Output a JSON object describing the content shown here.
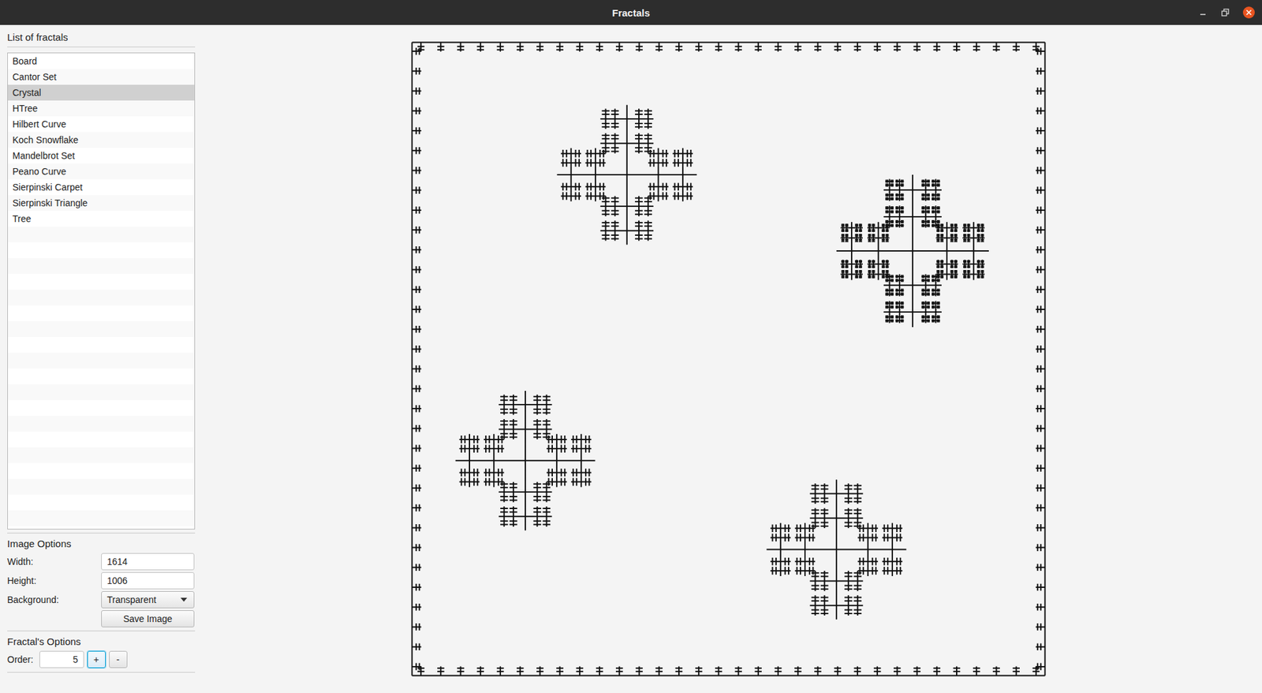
{
  "window": {
    "title": "Fractals"
  },
  "fractal_list": {
    "title": "List of fractals",
    "items": [
      {
        "label": "Board",
        "selected": false
      },
      {
        "label": "Cantor Set",
        "selected": false
      },
      {
        "label": "Crystal",
        "selected": true
      },
      {
        "label": "HTree",
        "selected": false
      },
      {
        "label": "Hilbert Curve",
        "selected": false
      },
      {
        "label": "Koch Snowflake",
        "selected": false
      },
      {
        "label": "Mandelbrot Set",
        "selected": false
      },
      {
        "label": "Peano Curve",
        "selected": false
      },
      {
        "label": "Sierpinski Carpet",
        "selected": false
      },
      {
        "label": "Sierpinski Triangle",
        "selected": false
      },
      {
        "label": "Tree",
        "selected": false
      }
    ]
  },
  "image_options": {
    "title": "Image Options",
    "fields": [
      {
        "label": "Width:",
        "value": "1614"
      },
      {
        "label": "Height:",
        "value": "1006"
      }
    ],
    "background": {
      "label": "Background:",
      "value": "Transparent"
    },
    "save_button": "Save Image"
  },
  "fractal_options": {
    "title": "Fractal's Options",
    "order": {
      "label": "Order:",
      "value": "5"
    },
    "buttons": [
      {
        "label": "+",
        "focused": true
      },
      {
        "label": "-",
        "focused": false
      }
    ]
  }
}
